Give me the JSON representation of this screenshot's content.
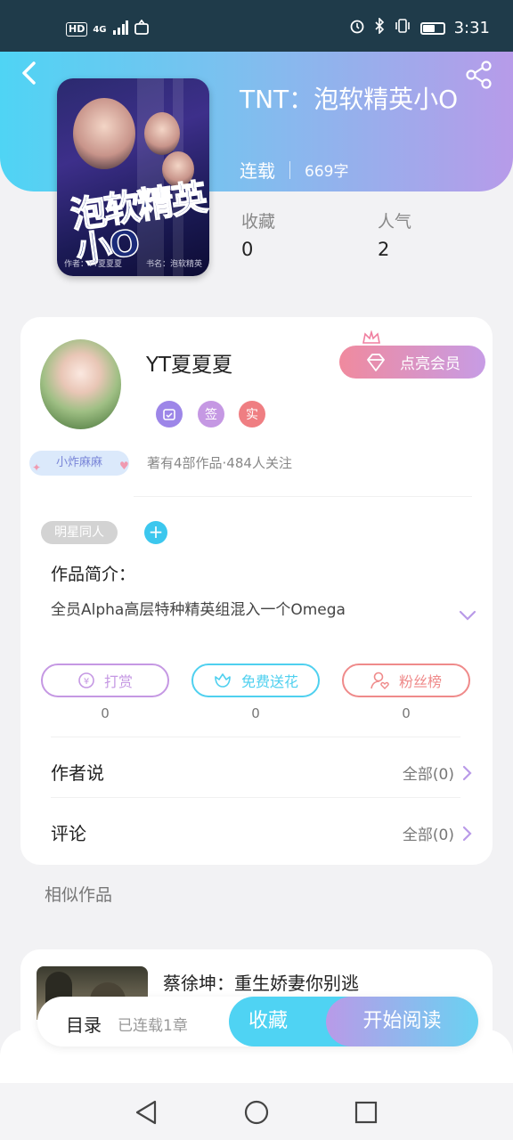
{
  "status_bar": {
    "network": "4G",
    "hd": "HD",
    "time": "3:31"
  },
  "header": {
    "title": "TNT：泡软精英小O",
    "serial_status": "连载",
    "word_count": "669字"
  },
  "cover": {
    "title_text": "泡软精英小O",
    "footer_left": "作者：YT夏夏夏",
    "footer_right": "书名：泡软精英"
  },
  "stats": {
    "favorites_label": "收藏",
    "favorites_value": "0",
    "popularity_label": "人气",
    "popularity_value": "2"
  },
  "author": {
    "name": "YT夏夏夏",
    "member_button": "点亮会员",
    "badge_sign": "签",
    "badge_real": "实",
    "fan_tag": "小炸麻麻",
    "meta": "著有4部作品·484人关注"
  },
  "genre_tag": "明星同人",
  "intro": {
    "label": "作品简介：",
    "text": "全员Alpha高层特种精英组混入一个Omega"
  },
  "actions": [
    {
      "label": "打赏",
      "count": "0",
      "color": "#c598e3"
    },
    {
      "label": "免费送花",
      "count": "0",
      "color": "#4fd0ef"
    },
    {
      "label": "粉丝榜",
      "count": "0",
      "color": "#ef8a8a"
    }
  ],
  "rows": {
    "author_says": {
      "label": "作者说",
      "right": "全部(0)"
    },
    "comments": {
      "label": "评论",
      "right": "全部(0)"
    }
  },
  "similar": {
    "heading": "相似作品",
    "item_title": "蔡徐坤：重生娇妻你别逃"
  },
  "bottom_bar": {
    "toc": "目录",
    "chapters": "已连载1章",
    "favorite": "收藏",
    "start_reading": "开始阅读"
  },
  "colors": {
    "accent_cyan": "#4fd3f3",
    "accent_purple": "#b99ae8",
    "accent_pink": "#f08a9e"
  }
}
